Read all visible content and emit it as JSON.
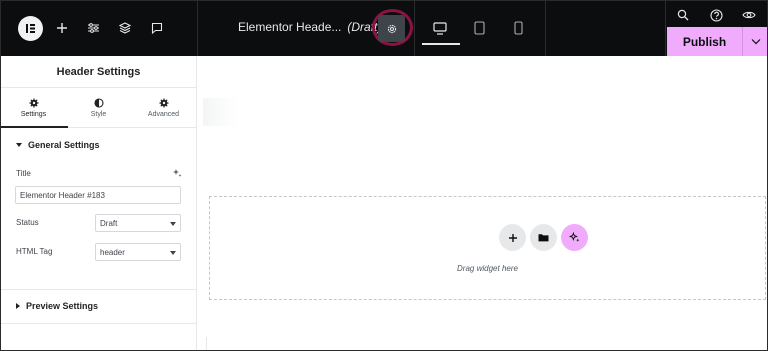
{
  "topbar": {
    "document_title": "Elementor Heade...",
    "document_status": "(Draft)",
    "publish_label": "Publish",
    "icons": [
      "elementor-logo-icon",
      "plus-icon",
      "sliders-icon",
      "layers-icon",
      "comment-icon",
      "chevron-down-icon",
      "gear-icon",
      "desktop-icon",
      "tablet-icon",
      "mobile-icon",
      "search-icon",
      "help-icon",
      "eye-icon"
    ]
  },
  "panel": {
    "title": "Header Settings",
    "tabs": [
      {
        "label": "Settings",
        "icon": "gear-icon"
      },
      {
        "label": "Style",
        "icon": "half-circle-icon"
      },
      {
        "label": "Advanced",
        "icon": "gear-icon"
      }
    ],
    "general_section": "General Settings",
    "title_label": "Title",
    "title_value": "Elementor Header #183",
    "status_label": "Status",
    "status_value": "Draft",
    "html_tag_label": "HTML Tag",
    "html_tag_value": "header",
    "preview_section": "Preview Settings"
  },
  "canvas": {
    "drop_text": "Drag widget here"
  },
  "colors": {
    "topbar_bg": "#0c0d0e",
    "accent_pink": "#f0abfc",
    "highlight_ring": "#8b1243"
  }
}
